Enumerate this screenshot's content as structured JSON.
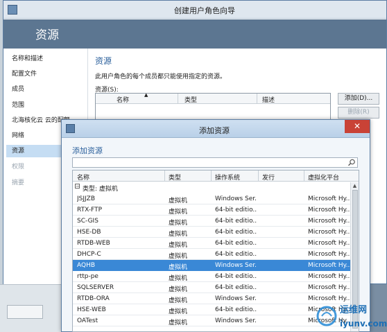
{
  "wizard": {
    "title": "创建用户角色向导",
    "header_title": "资源",
    "nav": [
      {
        "label": "名称和描述",
        "state": "normal"
      },
      {
        "label": "配置文件",
        "state": "normal"
      },
      {
        "label": "成员",
        "state": "normal"
      },
      {
        "label": "范围",
        "state": "normal"
      },
      {
        "label": "北海核化云 云的配额",
        "state": "normal"
      },
      {
        "label": "网络",
        "state": "normal"
      },
      {
        "label": "资源",
        "state": "active"
      },
      {
        "label": "权限",
        "state": "disabled"
      },
      {
        "label": "摘要",
        "state": "disabled"
      }
    ],
    "content_title": "资源",
    "description": "此用户角色的每个成员都只能使用指定的资源。",
    "resources_label": "资源(S):",
    "resources_columns": [
      "名称",
      "类型",
      "描述"
    ],
    "add_button": "添加(D)...",
    "remove_button": "删除(R)"
  },
  "dialog": {
    "title": "添加资源",
    "heading": "添加资源",
    "search_placeholder": "",
    "columns": [
      "名称",
      "类型",
      "操作系统",
      "发行",
      "虚拟化平台"
    ],
    "group_label": "类型: 虚拟机",
    "rows": [
      {
        "name": "JSJJZB",
        "type": "虚拟机",
        "os": "Windows Ser...",
        "release": "",
        "platform": "Microsoft Hy...",
        "selected": false
      },
      {
        "name": "RTX-FTP",
        "type": "虚拟机",
        "os": "64-bit editio...",
        "release": "",
        "platform": "Microsoft Hy...",
        "selected": false
      },
      {
        "name": "SC-GIS",
        "type": "虚拟机",
        "os": "64-bit editio...",
        "release": "",
        "platform": "Microsoft Hy...",
        "selected": false
      },
      {
        "name": "HSE-DB",
        "type": "虚拟机",
        "os": "64-bit editio...",
        "release": "",
        "platform": "Microsoft Hy...",
        "selected": false
      },
      {
        "name": "RTDB-WEB",
        "type": "虚拟机",
        "os": "64-bit editio...",
        "release": "",
        "platform": "Microsoft Hy...",
        "selected": false
      },
      {
        "name": "DHCP-C",
        "type": "虚拟机",
        "os": "64-bit editio...",
        "release": "",
        "platform": "Microsoft Hy...",
        "selected": false
      },
      {
        "name": "AQHB",
        "type": "虚拟机",
        "os": "Windows Ser...",
        "release": "",
        "platform": "Microsoft Hy...",
        "selected": true
      },
      {
        "name": "rttp-pe",
        "type": "虚拟机",
        "os": "64-bit editio...",
        "release": "",
        "platform": "Microsoft Hy...",
        "selected": false
      },
      {
        "name": "SQLSERVER",
        "type": "虚拟机",
        "os": "64-bit editio...",
        "release": "",
        "platform": "Microsoft Hy...",
        "selected": false
      },
      {
        "name": "RTDB-ORA",
        "type": "虚拟机",
        "os": "Windows Ser...",
        "release": "",
        "platform": "Microsoft Hy...",
        "selected": false
      },
      {
        "name": "HSE-WEB",
        "type": "虚拟机",
        "os": "64-bit editio...",
        "release": "",
        "platform": "Microsoft Hy...",
        "selected": false
      },
      {
        "name": "OATest",
        "type": "虚拟机",
        "os": "Windows Ser...",
        "release": "",
        "platform": "Microsoft Hy...",
        "selected": false
      }
    ]
  },
  "watermark": {
    "brand": "运维网",
    "url": "iyunv.com"
  },
  "colors": {
    "header_bg": "#5c7691",
    "accent_title": "#2a5f9b",
    "selection": "#3a88d6",
    "nav_active": "#c5ddf3",
    "close_button": "#c94236"
  }
}
